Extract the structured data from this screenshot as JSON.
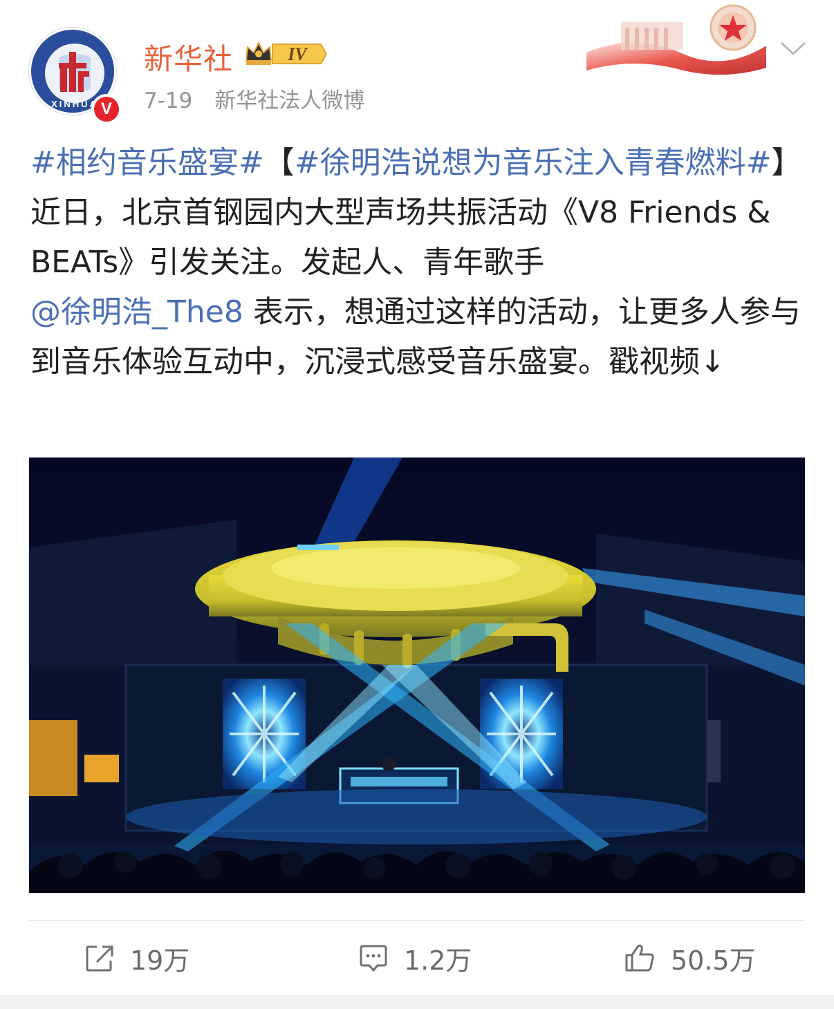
{
  "post": {
    "author": {
      "name": "新华社",
      "verified_badge": "V",
      "level_badge": "IV",
      "avatar_text": "XINHUA"
    },
    "time": "7-19",
    "source": "新华社法人微博",
    "content": {
      "hashtag_1": "#相约音乐盛宴#",
      "bracket_open": "【",
      "hashtag_2": "#徐明浩说想为音乐注入青春燃料#",
      "bracket_close": "】",
      "text_1": "近日，北京首钢园内大型声场共振活动《V8 Friends & BEATs》引发关注。发起人、青年歌手",
      "mention": "@徐明浩_The8",
      "text_2": " 表示，想通过这样的活动，让更多人参与到音乐体验互动中，沉浸式感受音乐盛宴。戳视频↓"
    },
    "media": {
      "type": "video-thumbnail",
      "subject": "concert-stage-with-lasers"
    },
    "actions": {
      "repost": "19万",
      "comment": "1.2万",
      "like": "50.5万"
    },
    "colors": {
      "name": "#e8633a",
      "link": "#4a6fb5",
      "meta": "#939393",
      "text": "#222222",
      "verified": "#e6232b"
    },
    "icons": [
      "chevron-down-icon",
      "repost-icon",
      "comment-icon",
      "like-icon",
      "crown-icon"
    ]
  }
}
